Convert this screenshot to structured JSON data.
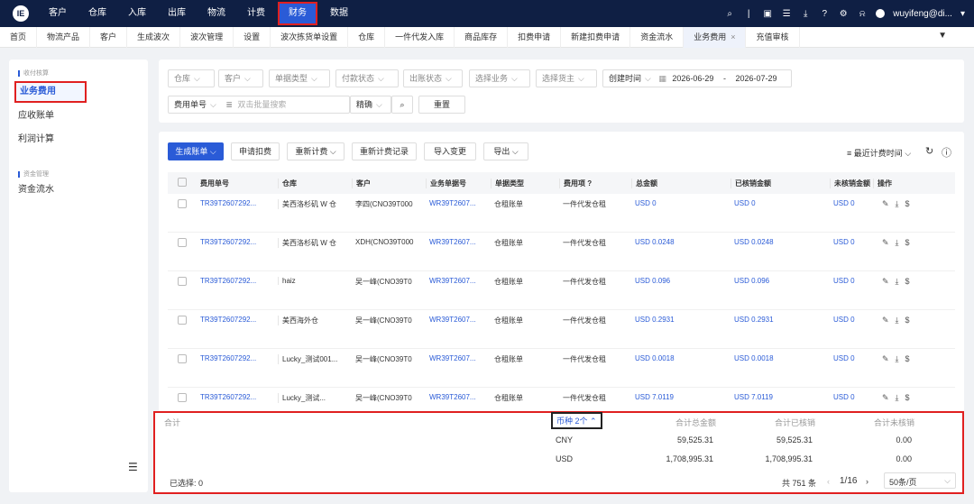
{
  "topbar": {
    "logo": "IE",
    "nav": [
      "客户",
      "仓库",
      "入库",
      "出库",
      "物流",
      "计费",
      "财务",
      "数据"
    ],
    "active_nav": "财务",
    "icons": [
      "search-icon",
      "divider",
      "screen-icon",
      "chat-icon",
      "download-icon",
      "help-icon",
      "settings-icon",
      "bell-icon"
    ],
    "user": "wuyifeng@di...",
    "user_arrow": "▾"
  },
  "tabs": [
    "首页",
    "物流产品",
    "客户",
    "生成波次",
    "波次管理",
    "设置",
    "波次拣货单设置",
    "仓库",
    "一件代发入库",
    "商品库存",
    "扣费申请",
    "新建扣费申请",
    "资金流水",
    "业务费用",
    "充值审核"
  ],
  "active_tab": "业务费用",
  "sidebar": {
    "section1": "收付核算",
    "items1": [
      "业务费用",
      "应收账单",
      "利润计算"
    ],
    "section2": "资金管理",
    "items2": [
      "资金流水"
    ]
  },
  "filters": {
    "row1": [
      "仓库",
      "客户",
      "单据类型",
      "付款状态",
      "出账状态",
      "选择业务",
      "选择货主",
      "创建时间"
    ],
    "date_start": "2026-06-29",
    "date_sep": "-",
    "date_end": "2026-07-29",
    "fee_no": "费用单号",
    "search_placeholder": "双击批量搜索",
    "match": "精确",
    "reset": "重置"
  },
  "toolbar": {
    "generate": "生成账单",
    "apply_deduct": "申请扣费",
    "recalc": "重新计费",
    "recalc_log": "重新计费记录",
    "import_change": "导入变更",
    "export": "导出",
    "sort": "最近计费时间"
  },
  "table": {
    "headers": [
      "费用单号",
      "仓库",
      "客户",
      "业务单据号",
      "单据类型",
      "费用项",
      "总金额",
      "已核销金额",
      "未核销金额",
      "操作"
    ],
    "rows": [
      [
        "TR39T2607292...",
        "美西洛杉矶 W 仓",
        "李四(CNO39T000",
        "WR39T2607...",
        "仓租账单",
        "一件代发仓租",
        "USD 0",
        "USD 0",
        "USD 0"
      ],
      [
        "TR39T2607292...",
        "美西洛杉矶 W 仓",
        "XDH(CNO39T000",
        "WR39T2607...",
        "仓租账单",
        "一件代发仓租",
        "USD 0.0248",
        "USD 0.0248",
        "USD 0"
      ],
      [
        "TR39T2607292...",
        "haiz",
        "吴一峰(CNO39T0",
        "WR39T2607...",
        "仓租账单",
        "一件代发仓租",
        "USD 0.096",
        "USD 0.096",
        "USD 0"
      ],
      [
        "TR39T2607292...",
        "美西海外仓",
        "吴一峰(CNO39T0",
        "WR39T2607...",
        "仓租账单",
        "一件代发仓租",
        "USD 0.2931",
        "USD 0.2931",
        "USD 0"
      ],
      [
        "TR39T2607292...",
        "Lucky_测试001...",
        "吴一峰(CNO39T0",
        "WR39T2607...",
        "仓租账单",
        "一件代发仓租",
        "USD 0.0018",
        "USD 0.0018",
        "USD 0"
      ],
      [
        "TR39T2607292...",
        "Lucky_测试...",
        "吴一峰(CNO39T0",
        "WR39T2607...",
        "仓租账单",
        "一件代发仓租",
        "USD 7.0119",
        "USD 7.0119",
        "USD 0"
      ]
    ]
  },
  "summary": {
    "label": "合计",
    "currency": "币种 2个",
    "col_total": "合计总金额",
    "col_verified": "合计已核销",
    "col_unverified": "合计未核销",
    "rows": [
      {
        "cur": "CNY",
        "total": "59,525.31",
        "verified": "59,525.31",
        "unverified": "0.00"
      },
      {
        "cur": "USD",
        "total": "1,708,995.31",
        "verified": "1,708,995.31",
        "unverified": "0.00"
      }
    ],
    "selected": "已选择: 0",
    "total_count": "共 751 条",
    "page": "1/16",
    "page_size": "50条/页"
  }
}
